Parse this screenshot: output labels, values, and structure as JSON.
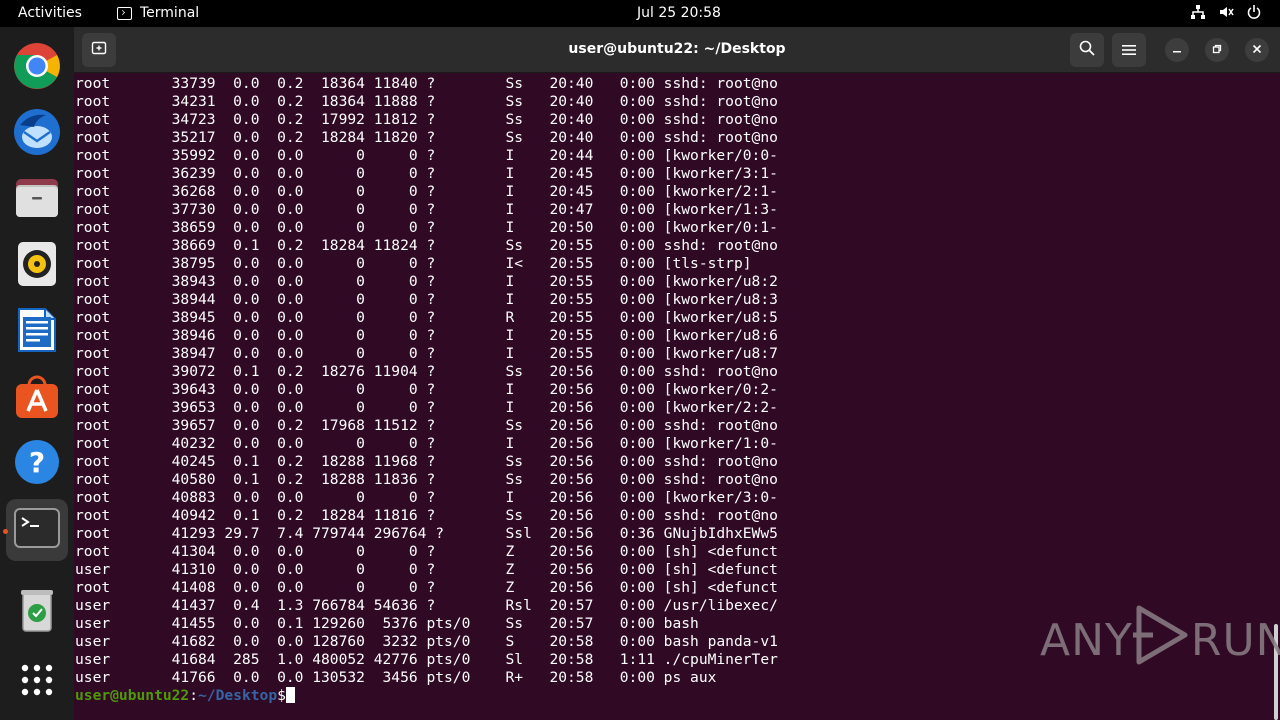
{
  "topbar": {
    "activities": "Activities",
    "app_name": "Terminal",
    "clock": "Jul 25  20:58"
  },
  "window": {
    "title": "user@ubuntu22: ~/Desktop"
  },
  "terminal": {
    "lines": [
      "root       33739  0.0  0.2  18364 11840 ?        Ss   20:40   0:00 sshd: root@no",
      "root       34231  0.0  0.2  18364 11888 ?        Ss   20:40   0:00 sshd: root@no",
      "root       34723  0.0  0.2  17992 11812 ?        Ss   20:40   0:00 sshd: root@no",
      "root       35217  0.0  0.2  18284 11820 ?        Ss   20:40   0:00 sshd: root@no",
      "root       35992  0.0  0.0      0     0 ?        I    20:44   0:00 [kworker/0:0-",
      "root       36239  0.0  0.0      0     0 ?        I    20:45   0:00 [kworker/3:1-",
      "root       36268  0.0  0.0      0     0 ?        I    20:45   0:00 [kworker/2:1-",
      "root       37730  0.0  0.0      0     0 ?        I    20:47   0:00 [kworker/1:3-",
      "root       38659  0.0  0.0      0     0 ?        I    20:50   0:00 [kworker/0:1-",
      "root       38669  0.1  0.2  18284 11824 ?        Ss   20:55   0:00 sshd: root@no",
      "root       38795  0.0  0.0      0     0 ?        I<   20:55   0:00 [tls-strp]",
      "root       38943  0.0  0.0      0     0 ?        I    20:55   0:00 [kworker/u8:2",
      "root       38944  0.0  0.0      0     0 ?        I    20:55   0:00 [kworker/u8:3",
      "root       38945  0.0  0.0      0     0 ?        R    20:55   0:00 [kworker/u8:5",
      "root       38946  0.0  0.0      0     0 ?        I    20:55   0:00 [kworker/u8:6",
      "root       38947  0.0  0.0      0     0 ?        I    20:55   0:00 [kworker/u8:7",
      "root       39072  0.1  0.2  18276 11904 ?        Ss   20:56   0:00 sshd: root@no",
      "root       39643  0.0  0.0      0     0 ?        I    20:56   0:00 [kworker/0:2-",
      "root       39653  0.0  0.0      0     0 ?        I    20:56   0:00 [kworker/2:2-",
      "root       39657  0.0  0.2  17968 11512 ?        Ss   20:56   0:00 sshd: root@no",
      "root       40232  0.0  0.0      0     0 ?        I    20:56   0:00 [kworker/1:0-",
      "root       40245  0.1  0.2  18288 11968 ?        Ss   20:56   0:00 sshd: root@no",
      "root       40580  0.1  0.2  18288 11836 ?        Ss   20:56   0:00 sshd: root@no",
      "root       40883  0.0  0.0      0     0 ?        I    20:56   0:00 [kworker/3:0-",
      "root       40942  0.1  0.2  18284 11816 ?        Ss   20:56   0:00 sshd: root@no",
      "root       41293 29.7  7.4 779744 296764 ?       Ssl  20:56   0:36 GNujbIdhxEWw5",
      "root       41304  0.0  0.0      0     0 ?        Z    20:56   0:00 [sh] <defunct",
      "user       41310  0.0  0.0      0     0 ?        Z    20:56   0:00 [sh] <defunct",
      "root       41408  0.0  0.0      0     0 ?        Z    20:56   0:00 [sh] <defunct",
      "user       41437  0.4  1.3 766784 54636 ?        Rsl  20:57   0:00 /usr/libexec/",
      "user       41455  0.0  0.1 129260  5376 pts/0    Ss   20:57   0:00 bash",
      "user       41682  0.0  0.0 128760  3232 pts/0    S    20:58   0:00 bash panda-v1",
      "user       41684  285  1.0 480052 42776 pts/0    Sl   20:58   1:11 ./cpuMinerTer",
      "user       41766  0.0  0.0 130532  3456 pts/0    R+   20:58   0:00 ps aux"
    ],
    "prompt_user": "user@ubuntu22",
    "prompt_sep": ":",
    "prompt_path": "~/Desktop",
    "prompt_end": "$"
  },
  "watermark": {
    "left": "ANY",
    "right": "RUN"
  },
  "colors": {
    "terminal_bg": "#300a24",
    "prompt_green": "#4e9a06",
    "prompt_blue": "#3465a4",
    "accent_orange": "#e95420"
  },
  "icons": {
    "dock": [
      "chrome-icon",
      "thunderbird-icon",
      "files-icon",
      "rhythmbox-icon",
      "writer-icon",
      "app-center-icon",
      "help-icon",
      "terminal-icon",
      "trash-icon",
      "app-grid-icon"
    ]
  }
}
